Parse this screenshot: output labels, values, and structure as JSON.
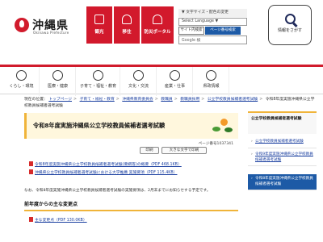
{
  "header": {
    "logo_name": "沖縄県",
    "logo_roman": "Okinawa Prefecture",
    "quick_links": [
      {
        "label": "観光",
        "icon": "camera-icon"
      },
      {
        "label": "移住",
        "icon": "airplane-icon"
      },
      {
        "label": "防災ポータル",
        "icon": "bell-icon"
      }
    ],
    "settings": {
      "text_size_label": "▼ 文字サイズ・配色の変更",
      "language_select": "Select Language ▼",
      "site_search_label": "サイト内検索",
      "page_search_label": "ページ番号検索",
      "search_placeholder": "Google 検"
    },
    "search_info_label": "情報をさがす",
    "accent_color": "#d2192c"
  },
  "catnav": {
    "items": [
      {
        "label": "くらし・環境",
        "icon": "leaf-icon"
      },
      {
        "label": "医療・健康",
        "icon": "medical-icon"
      },
      {
        "label": "子育て・福祉・教育",
        "icon": "family-icon"
      },
      {
        "label": "文化・交流",
        "icon": "culture-icon"
      },
      {
        "label": "産業・仕事",
        "icon": "industry-icon"
      },
      {
        "label": "県政情報",
        "icon": "building-icon"
      }
    ]
  },
  "breadcrumb": {
    "prefix": "現在の位置：",
    "links": [
      "トップページ",
      "子育て・福祉・教育",
      "沖縄県教育委員会",
      "教職員",
      "教職員採用"
    ],
    "middle_link": "公立学校教員候補者選考試験",
    "current": "令和8年度実施沖縄県公立学校教員候補者選考試験"
  },
  "main": {
    "title": "令和8年度実施沖縄県公立学校教員候補者選考試験",
    "page_id": "ページ番号1037341",
    "print_label": "印刷",
    "print_large_label": "大きな文字で印刷",
    "files": [
      "令和8年度実施沖縄県公立学校教員候補者選考試験(要綱等)の概要（PDF 468.1KB）",
      "沖縄県公立学校教員候補者選考試験における大学推薦 実施要項（PDF 115.4KB）"
    ],
    "notice": "なお、令和8年度実施沖縄県公立学校教員候補者選考試験の実施要項は、2月末までにお知らせする予定です。",
    "section_title": "前年度からの主な変更点",
    "change_file": "主な変更点（PDF 130.0KB）"
  },
  "sidebar": {
    "heading": "公立学校教員候補者選考試験",
    "items": [
      {
        "label": "公立学校教員候補者選考試験",
        "active": false
      },
      {
        "label": "令和9年度実施沖縄県公立学校教員候補者選考試験",
        "active": false
      },
      {
        "label": "令和8年度実施沖縄県公立学校教員候補者選考試験",
        "active": true
      }
    ]
  }
}
